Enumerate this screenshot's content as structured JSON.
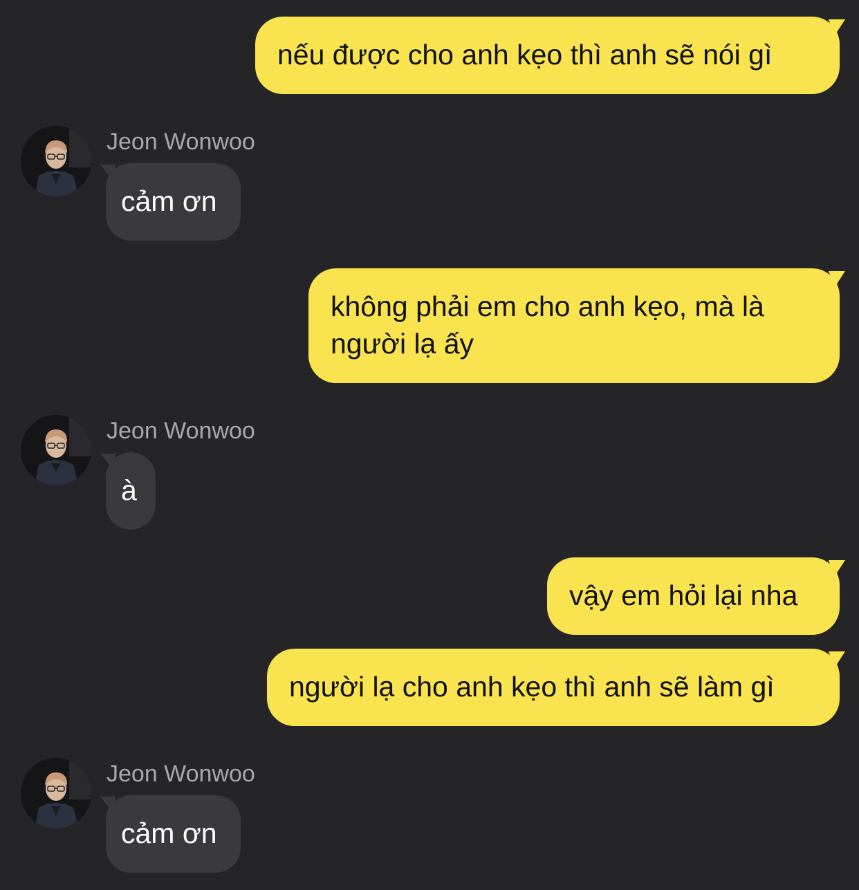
{
  "chat": {
    "colors": {
      "background": "#252527",
      "outgoing_bubble": "#f9e450",
      "incoming_bubble": "#3a3a3c",
      "sender_name": "#a9a9ad"
    },
    "messages": [
      {
        "direction": "outgoing",
        "text": "nếu được cho anh kẹo thì anh sẽ nói gì"
      },
      {
        "direction": "incoming",
        "sender": "Jeon Wonwoo",
        "avatar_icon": "profile-photo-icon",
        "text": "cảm ơn"
      },
      {
        "direction": "outgoing",
        "text": "không phải em cho anh kẹo, mà là người lạ ấy"
      },
      {
        "direction": "incoming",
        "sender": "Jeon Wonwoo",
        "avatar_icon": "profile-photo-icon",
        "text": "à"
      },
      {
        "direction": "outgoing",
        "text": "vậy em hỏi lại nha"
      },
      {
        "direction": "outgoing",
        "text": "người lạ cho anh kẹo thì anh sẽ làm gì"
      },
      {
        "direction": "incoming",
        "sender": "Jeon Wonwoo",
        "avatar_icon": "profile-photo-icon",
        "text": "cảm ơn"
      }
    ]
  }
}
